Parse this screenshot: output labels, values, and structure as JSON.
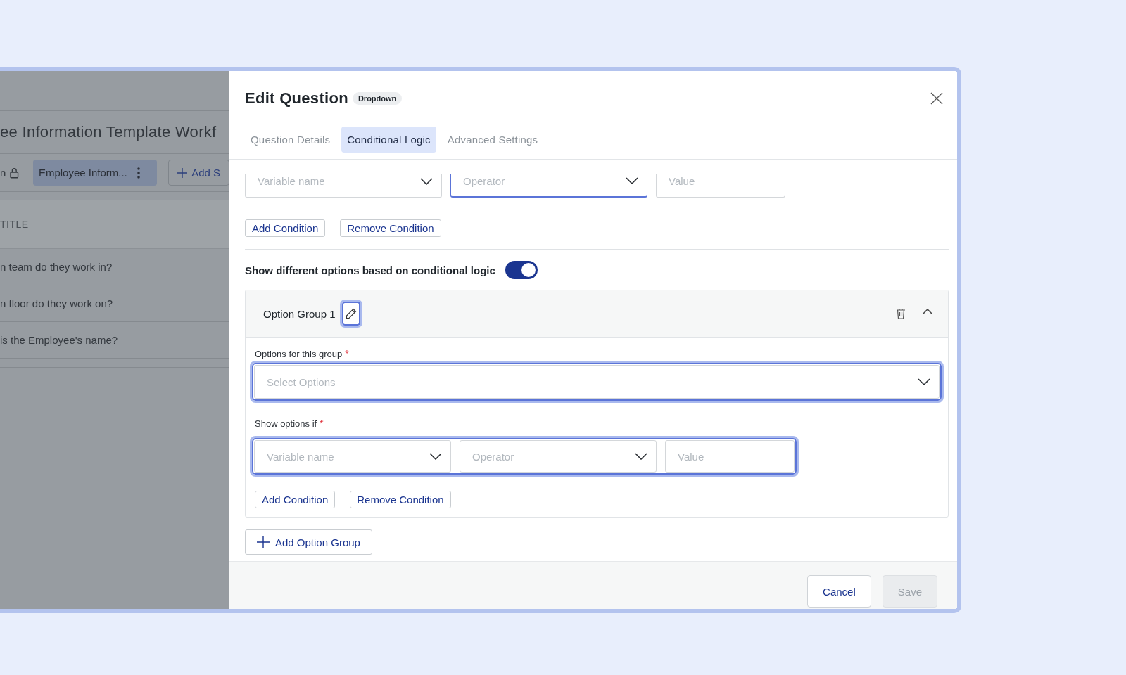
{
  "background": {
    "title": "ee Information Template Workf",
    "toolbar": {
      "label": "n",
      "chip": "Employee Inform...",
      "add_button": "Add S"
    },
    "column_header": "TITLE",
    "rows": [
      "n team do they work in?",
      "n floor do they work on?",
      "is the Employee's name?"
    ]
  },
  "dialog": {
    "title": "Edit Question",
    "badge": "Dropdown",
    "tabs": [
      {
        "label": "Question Details",
        "selected": false
      },
      {
        "label": "Conditional Logic",
        "selected": true
      },
      {
        "label": "Advanced Settings",
        "selected": false
      }
    ],
    "top_condition": {
      "fields": [
        {
          "kind": "select",
          "placeholder": "Variable name",
          "focused": false
        },
        {
          "kind": "select",
          "placeholder": "Operator",
          "focused": true
        },
        {
          "kind": "text",
          "placeholder": "Value",
          "focused": false
        }
      ],
      "buttons": [
        "Add Condition",
        "Remove Condition"
      ]
    },
    "toggle": {
      "label": "Show different options based on conditional logic",
      "on": true
    },
    "option_group": {
      "title": "Option Group 1",
      "expanded": true,
      "edit_highlighted": true,
      "options_label": "Options for this group",
      "options_required_mark": "*",
      "options_placeholder": "Select Options",
      "options_highlighted": true,
      "show_if_label": "Show options if",
      "show_if_required_mark": "*",
      "conditions_highlighted": true,
      "fields": [
        {
          "kind": "select",
          "placeholder": "Variable name",
          "focused": false
        },
        {
          "kind": "select",
          "placeholder": "Operator",
          "focused": false
        },
        {
          "kind": "text",
          "placeholder": "Value",
          "focused": false
        }
      ],
      "buttons": [
        "Add Condition",
        "Remove Condition"
      ]
    },
    "add_group_button": "Add Option Group",
    "footer": {
      "cancel": "Cancel",
      "save": {
        "label": "Save",
        "disabled": true
      }
    }
  }
}
